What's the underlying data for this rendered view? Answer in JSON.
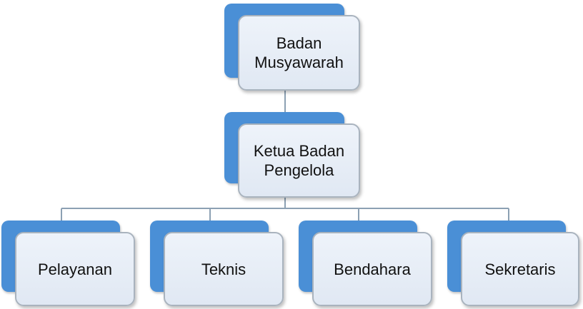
{
  "diagram": {
    "top": {
      "line1": "Badan",
      "line2": "Musyawarah"
    },
    "middle": {
      "line1": "Ketua Badan",
      "line2": "Pengelola"
    },
    "children": [
      "Pelayanan",
      "Teknis",
      "Bendahara",
      "Sekretaris"
    ]
  },
  "colors": {
    "accent_back": "#4a8fd6",
    "box_front": "#e6edf6",
    "border": "#a9b3be",
    "connector": "#8ca0b3"
  }
}
